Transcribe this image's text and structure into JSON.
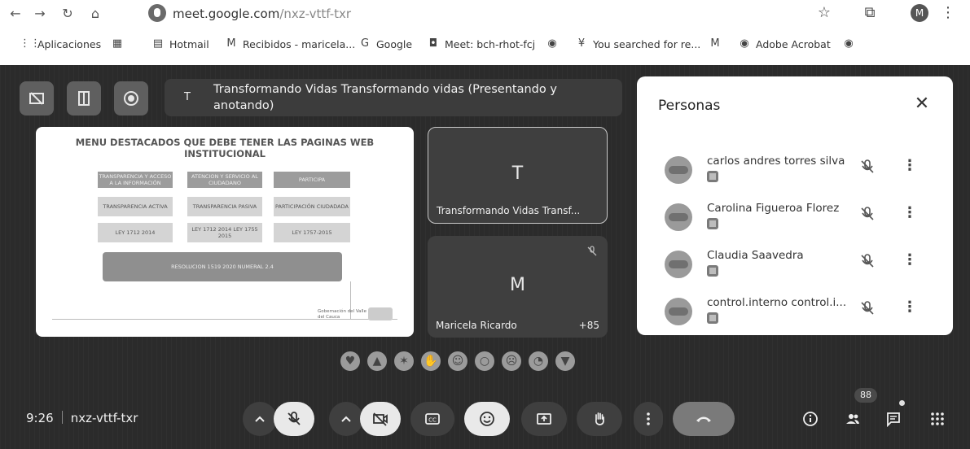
{
  "browser": {
    "url_host": "meet.google.com",
    "url_path": "/nxz-vttf-txr",
    "profile_initial": "M"
  },
  "bookmarks": [
    {
      "label": "Aplicaciones",
      "icon": "apps-grid-icon"
    },
    {
      "label": "",
      "icon": "grid-icon"
    },
    {
      "label": "Hotmail",
      "icon": "hotmail-icon"
    },
    {
      "label": "Recibidos - maricela...",
      "icon": "gmail-icon"
    },
    {
      "label": "Google",
      "icon": "google-icon"
    },
    {
      "label": "Meet: bch-rhot-fcj",
      "icon": "meet-icon"
    },
    {
      "label": "",
      "icon": "globe-icon"
    },
    {
      "label": "You searched for re...",
      "icon": "pin-icon"
    },
    {
      "label": "",
      "icon": "gmail-icon"
    },
    {
      "label": "Adobe Acrobat",
      "icon": "globe-icon"
    },
    {
      "label": "",
      "icon": "globe-icon"
    }
  ],
  "presentation": {
    "avatar_initial": "T",
    "title": "Transformando Vidas Transformando vidas (Presentando y anotando)"
  },
  "slide": {
    "title": "MENU DESTACADOS QUE DEBE TENER LAS PAGINAS WEB INSTITUCIONAL",
    "col1_header": "TRANSPARENCIA Y ACCESO A LA INFORMACIÓN",
    "col2_header": "ATENCION Y SERVICIO AL CIUDADANO",
    "col3_header": "PARTICIPA",
    "col1_item1": "TRANSPARENCIA ACTIVA",
    "col2_item1": "TRANSPARENCIA PASIVA",
    "col3_item1": "PARTICIPACIÓN CIUDADADA",
    "col1_item2": "LEY 1712 2014",
    "col2_item2": "LEY 1712 2014 LEY 1755 2015",
    "col3_item2": "LEY 1757-2015",
    "bar": "RESOLUCION 1519 2020 NUMERAL 2.4",
    "logo_text": "Gobernación del Valle del Cauca"
  },
  "tiles": [
    {
      "initial": "T",
      "name": "Transformando Vidas Transf..."
    },
    {
      "initial": "M",
      "name": "Maricela Ricardo",
      "extra": "+85"
    }
  ],
  "people_panel": {
    "title": "Personas",
    "people": [
      {
        "name": "carlos andres torres silva"
      },
      {
        "name": "Carolina Figueroa Florez"
      },
      {
        "name": "Claudia Saavedra"
      },
      {
        "name": "control.interno control.i..."
      }
    ]
  },
  "meeting": {
    "time": "9:26",
    "code": "nxz-vttf-txr",
    "participant_count": "88"
  }
}
